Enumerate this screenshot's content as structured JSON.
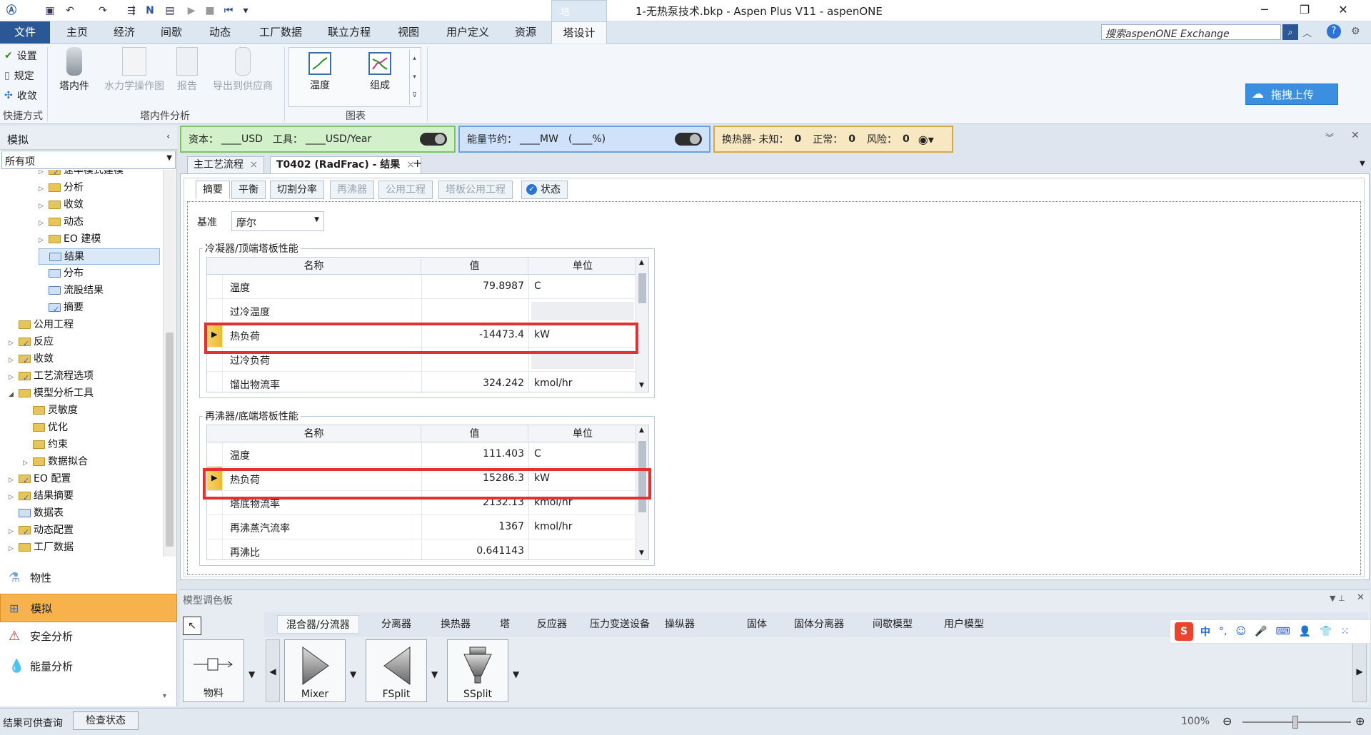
{
  "title_bar": {
    "window_title": "1-无热泵技术.bkp - Aspen Plus V11 - aspenONE",
    "context_tab": "塔",
    "app_logo": "aspen-logo-icon"
  },
  "menu": {
    "file": "文件",
    "tabs": [
      "主页",
      "经济",
      "间歇",
      "动态",
      "工厂数据",
      "联立方程",
      "视图",
      "用户定义",
      "资源",
      "塔设计"
    ],
    "search_placeholder": "搜索aspenONE Exchange"
  },
  "ribbon": {
    "quick": {
      "items": [
        "设置",
        "规定",
        "收敛"
      ],
      "group_label": "快捷方式"
    },
    "internals": {
      "items": [
        "塔内件",
        "水力学操作图",
        "报告",
        "导出到供应商"
      ],
      "group_label": "塔内件分析"
    },
    "charts": {
      "items": [
        "温度",
        "组成"
      ],
      "group_label": "图表"
    },
    "upload_button": "拖拽上传"
  },
  "notifications": {
    "cost": {
      "capital_label": "资本：",
      "capital_value": "____USD",
      "utility_label": "工具：",
      "utility_value": "____USD/Year"
    },
    "energy": {
      "label": "能量节约：",
      "mw_value": "____MW",
      "pct_value": "(____%)"
    },
    "hx": {
      "label": "换热器- 未知：",
      "unknown": "0",
      "normal_label": "正常：",
      "normal": "0",
      "risk_label": "风险：",
      "risk": "0"
    }
  },
  "nav": {
    "header": "模拟",
    "filter": "所有项",
    "tree": [
      {
        "label": "速率模式建模",
        "depth": 3,
        "arrow": "▷",
        "icon": "folder-check"
      },
      {
        "label": "分析",
        "depth": 3,
        "arrow": "▷",
        "icon": "folder"
      },
      {
        "label": "收敛",
        "depth": 3,
        "arrow": "▷",
        "icon": "folder"
      },
      {
        "label": "动态",
        "depth": 3,
        "arrow": "▷",
        "icon": "folder"
      },
      {
        "label": "EO 建模",
        "depth": 3,
        "arrow": "▷",
        "icon": "folder"
      },
      {
        "label": "结果",
        "depth": 3,
        "arrow": "",
        "icon": "doc",
        "selected": true
      },
      {
        "label": "分布",
        "depth": 3,
        "arrow": "",
        "icon": "doc"
      },
      {
        "label": "流股结果",
        "depth": 3,
        "arrow": "",
        "icon": "doc"
      },
      {
        "label": "摘要",
        "depth": 3,
        "arrow": "",
        "icon": "check"
      },
      {
        "label": "公用工程",
        "depth": 1,
        "arrow": "",
        "icon": "folder"
      },
      {
        "label": "反应",
        "depth": 1,
        "arrow": "▷",
        "icon": "folder-check"
      },
      {
        "label": "收敛",
        "depth": 1,
        "arrow": "▷",
        "icon": "folder-check"
      },
      {
        "label": "工艺流程选项",
        "depth": 1,
        "arrow": "▷",
        "icon": "folder-check"
      },
      {
        "label": "模型分析工具",
        "depth": 1,
        "arrow": "◢",
        "icon": "folder"
      },
      {
        "label": "灵敏度",
        "depth": 2,
        "arrow": "",
        "icon": "folder"
      },
      {
        "label": "优化",
        "depth": 2,
        "arrow": "",
        "icon": "folder"
      },
      {
        "label": "约束",
        "depth": 2,
        "arrow": "",
        "icon": "folder"
      },
      {
        "label": "数据拟合",
        "depth": 2,
        "arrow": "▷",
        "icon": "folder"
      },
      {
        "label": "EO 配置",
        "depth": 1,
        "arrow": "▷",
        "icon": "folder-check"
      },
      {
        "label": "结果摘要",
        "depth": 1,
        "arrow": "▷",
        "icon": "folder-check"
      },
      {
        "label": "数据表",
        "depth": 1,
        "arrow": "",
        "icon": "doc"
      },
      {
        "label": "动态配置",
        "depth": 1,
        "arrow": "▷",
        "icon": "folder-check"
      },
      {
        "label": "工厂数据",
        "depth": 1,
        "arrow": "▷",
        "icon": "folder"
      }
    ],
    "buttons": [
      "物性",
      "模拟",
      "安全分析",
      "能量分析"
    ]
  },
  "content": {
    "doc_tabs": [
      "主工艺流程",
      "T0402 (RadFrac) - 结果"
    ],
    "sub_tabs": [
      "摘要",
      "平衡",
      "切割分率",
      "再沸器",
      "公用工程",
      "塔板公用工程",
      "状态"
    ],
    "basis_label": "基准",
    "basis_value": "摩尔",
    "condenser": {
      "title": "冷凝器/顶端塔板性能",
      "headers": [
        "名称",
        "值",
        "单位"
      ],
      "rows": [
        {
          "name": "温度",
          "value": "79.8987",
          "unit": "C"
        },
        {
          "name": "过冷温度",
          "value": "",
          "unit": ""
        },
        {
          "name": "热负荷",
          "value": "-14473.4",
          "unit": "kW"
        },
        {
          "name": "过冷负荷",
          "value": "",
          "unit": ""
        },
        {
          "name": "馏出物流率",
          "value": "324.242",
          "unit": "kmol/hr"
        }
      ]
    },
    "reboiler": {
      "title": "再沸器/底端塔板性能",
      "headers": [
        "名称",
        "值",
        "单位"
      ],
      "rows": [
        {
          "name": "温度",
          "value": "111.403",
          "unit": "C"
        },
        {
          "name": "热负荷",
          "value": "15286.3",
          "unit": "kW"
        },
        {
          "name": "塔底物流率",
          "value": "2132.13",
          "unit": "kmol/hr"
        },
        {
          "name": "再沸蒸汽流率",
          "value": "1367",
          "unit": "kmol/hr"
        },
        {
          "name": "再沸比",
          "value": "0.641143",
          "unit": ""
        }
      ]
    }
  },
  "palette": {
    "title": "模型调色板",
    "tabs": [
      "混合器/分流器",
      "分离器",
      "换热器",
      "塔",
      "反应器",
      "压力变送设备",
      "操纵器",
      "固体",
      "固体分离器",
      "间歇模型",
      "用户模型"
    ],
    "items": [
      "物料",
      "Mixer",
      "FSplit",
      "SSplit"
    ]
  },
  "status": {
    "text": "结果可供查询",
    "button": "检查状态",
    "zoom": "100%"
  },
  "ime": {
    "label": "中"
  }
}
